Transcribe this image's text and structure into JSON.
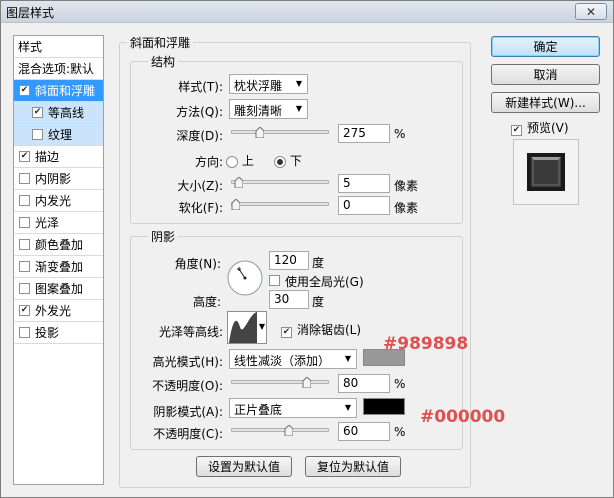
{
  "window": {
    "title": "图层样式",
    "close_glyph": "✕"
  },
  "left_panel": {
    "header": "样式",
    "blend_default": "混合选项:默认",
    "items": [
      {
        "label": "斜面和浮雕",
        "checked": true
      },
      {
        "label": "等高线",
        "checked": true
      },
      {
        "label": "纹理",
        "checked": false
      },
      {
        "label": "描边",
        "checked": true
      },
      {
        "label": "内阴影",
        "checked": false
      },
      {
        "label": "内发光",
        "checked": false
      },
      {
        "label": "光泽",
        "checked": false
      },
      {
        "label": "颜色叠加",
        "checked": false
      },
      {
        "label": "渐变叠加",
        "checked": false
      },
      {
        "label": "图案叠加",
        "checked": false
      },
      {
        "label": "外发光",
        "checked": true
      },
      {
        "label": "投影",
        "checked": false
      }
    ]
  },
  "bevel": {
    "group_title": "斜面和浮雕",
    "structure_title": "结构",
    "style_label": "样式(T):",
    "style_value": "枕状浮雕",
    "technique_label": "方法(Q):",
    "technique_value": "雕刻清晰",
    "depth_label": "深度(D):",
    "depth_value": "275",
    "depth_unit": "%",
    "depth_fraction": 0.27,
    "direction_label": "方向:",
    "dir_up": "上",
    "dir_down": "下",
    "size_label": "大小(Z):",
    "size_value": "5",
    "size_unit": "像素",
    "size_fraction": 0.03,
    "soften_label": "软化(F):",
    "soften_value": "0",
    "soften_unit": "像素",
    "soften_fraction": 0.0
  },
  "shading": {
    "title": "阴影",
    "angle_label": "角度(N):",
    "angle_value": "120",
    "angle_unit": "度",
    "global_light_label": "使用全局光(G)",
    "altitude_label": "高度:",
    "altitude_value": "30",
    "altitude_unit": "度",
    "gloss_label": "光泽等高线:",
    "anti_alias_label": "消除锯齿(L)",
    "highlight_mode_label": "高光模式(H):",
    "highlight_mode_value": "线性减淡（添加）",
    "highlight_color": "#989898",
    "highlight_opacity_label": "不透明度(O):",
    "highlight_opacity_value": "80",
    "highlight_opacity_fraction": 0.8,
    "shadow_mode_label": "阴影模式(A):",
    "shadow_mode_value": "正片叠底",
    "shadow_color": "#000000",
    "shadow_opacity_label": "不透明度(C):",
    "shadow_opacity_value": "60",
    "shadow_opacity_fraction": 0.6,
    "percent": "%"
  },
  "annotations": {
    "highlight_hex": "#989898",
    "shadow_hex": "#000000"
  },
  "footer": {
    "make_default": "设置为默认值",
    "reset_default": "复位为默认值"
  },
  "buttons": {
    "ok": "确定",
    "cancel": "取消",
    "new_style": "新建样式(W)...",
    "preview": "预览(V)"
  }
}
